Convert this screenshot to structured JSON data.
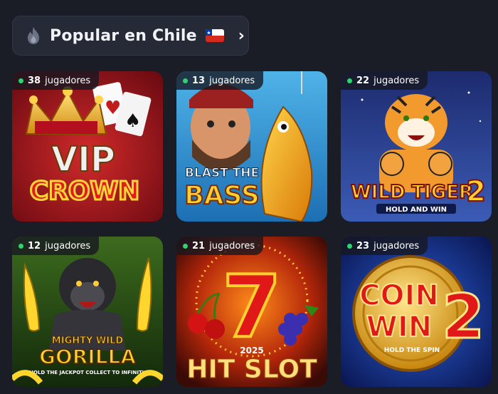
{
  "header": {
    "title": "Popular en Chile",
    "icon": "fire-icon",
    "flag": "chile-flag-icon",
    "chevron": "›"
  },
  "games": [
    {
      "name": "VIP CROWN",
      "players_count": "38",
      "players_word": "jugadores"
    },
    {
      "name": "BLAST THE BASS",
      "players_count": "13",
      "players_word": "jugadores"
    },
    {
      "name": "WILD TIGER 2",
      "subtitle": "HOLD AND WIN",
      "players_count": "22",
      "players_word": "jugadores"
    },
    {
      "name": "MIGHTY WILD GORILLA",
      "subtitle": "HOLD THE JACKPOT COLLECT TO INFINITY",
      "players_count": "12",
      "players_word": "jugadores"
    },
    {
      "name": "HIT SLOT",
      "year": "2025",
      "players_count": "21",
      "players_word": "jugadores"
    },
    {
      "name": "COIN WIN 2",
      "subtitle": "HOLD THE SPIN",
      "players_count": "23",
      "players_word": "jugadores"
    }
  ],
  "colors": {
    "background": "#1b1d26",
    "online_dot": "#2fd36f",
    "pill": "#262a36"
  }
}
